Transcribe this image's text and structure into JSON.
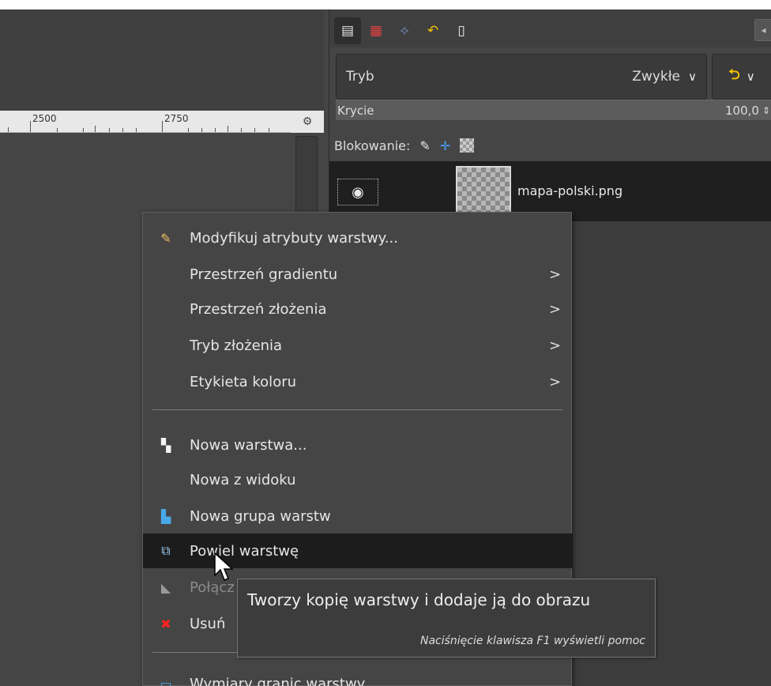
{
  "ruler": {
    "label_2500": "2500",
    "label_2750": "2750",
    "corner_icon": "zoom-icon"
  },
  "dock": {
    "tabs": [
      {
        "icon": "layers-icon",
        "glyph": "▤"
      },
      {
        "icon": "channels-icon",
        "glyph": "▦"
      },
      {
        "icon": "paths-icon",
        "glyph": "⟡"
      },
      {
        "icon": "undo-history-icon",
        "glyph": "↶"
      },
      {
        "icon": "document-icon",
        "glyph": "▯"
      }
    ],
    "mode_label": "Tryb",
    "mode_value": "Zwykłe",
    "opacity_label": "Krycie",
    "opacity_value": "100,0",
    "lock_label": "Blokowanie:",
    "layer_name": "mapa-polski.png"
  },
  "context_menu": {
    "items": [
      {
        "label": "Modyfikuj atrybuty warstwy...",
        "icon": "edit-attributes-icon",
        "submenu": false
      },
      {
        "label": "Przestrzeń gradientu",
        "icon": "",
        "submenu": true
      },
      {
        "label": "Przestrzeń złożenia",
        "icon": "",
        "submenu": true
      },
      {
        "label": "Tryb złożenia",
        "icon": "",
        "submenu": true
      },
      {
        "label": "Etykieta koloru",
        "icon": "",
        "submenu": true
      },
      {
        "label": "Nowa warstwa...",
        "icon": "new-layer-icon",
        "submenu": false
      },
      {
        "label": "Nowa z widoku",
        "icon": "",
        "submenu": false
      },
      {
        "label": "Nowa grupa warstw",
        "icon": "new-group-icon",
        "submenu": false
      },
      {
        "label": "Powiel warstwę",
        "icon": "duplicate-layer-icon",
        "submenu": false,
        "highlighted": true
      },
      {
        "label": "Połącz",
        "icon": "merge-down-icon",
        "submenu": false,
        "disabled": true
      },
      {
        "label": "Usuń",
        "icon": "delete-icon",
        "submenu": false
      },
      {
        "label": "Wymiary granic warstwy",
        "icon": "layer-boundary-icon",
        "submenu": false
      }
    ]
  },
  "tooltip": {
    "text": "Tworzy kopię warstwy i dodaje ją do obrazu",
    "help_hint": "Naciśnięcie klawisza F1 wyświetli pomoc"
  }
}
